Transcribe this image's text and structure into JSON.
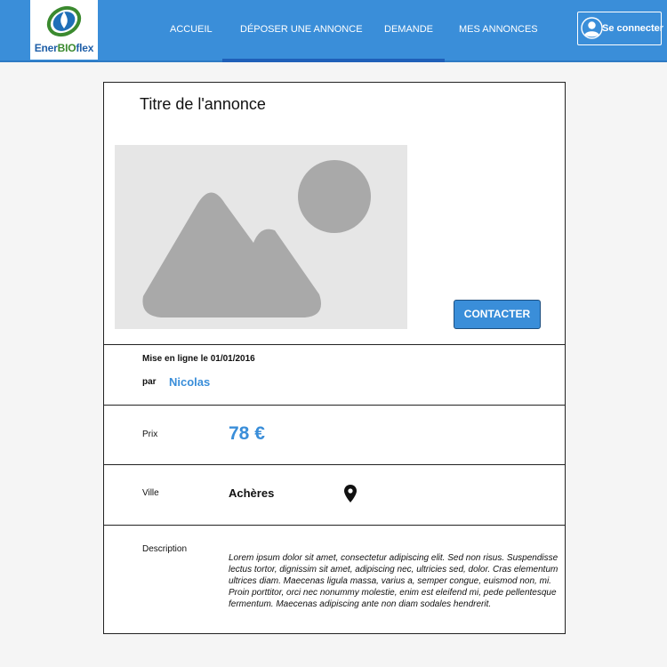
{
  "header": {
    "logo_text_a": "Ener",
    "logo_text_b": "BIO",
    "logo_text_c": "flex",
    "nav": [
      {
        "label": "ACCUEIL"
      },
      {
        "label": "DÉPOSER UNE ANNONCE"
      },
      {
        "label": "DEMANDE"
      },
      {
        "label": "MES ANNONCES"
      }
    ],
    "login_label": "Se connecter"
  },
  "listing": {
    "title": "Titre de l'annonce",
    "contact_label": "CONTACTER",
    "posted_label": "Mise en ligne le 01/01/2016",
    "by_label": "par",
    "author": "Nicolas",
    "price_label": "Prix",
    "price": "78  €",
    "city_label": "Ville",
    "city": "Achères",
    "description_label": "Description",
    "description": "Lorem ipsum dolor sit amet, consectetur adipiscing elit. Sed non risus. Suspendisse lectus tortor, dignissim sit amet, adipiscing nec, ultricies sed, dolor. Cras elementum ultrices diam. Maecenas ligula massa, varius a, semper congue, euismod non, mi. Proin porttitor, orci nec nonummy molestie, enim est eleifend mi, pede pellentesque fermentum. Maecenas adipiscing ante non diam sodales hendrerit."
  },
  "colors": {
    "brand_blue": "#3a8ed9",
    "nav_active": "#1f5fb8"
  }
}
